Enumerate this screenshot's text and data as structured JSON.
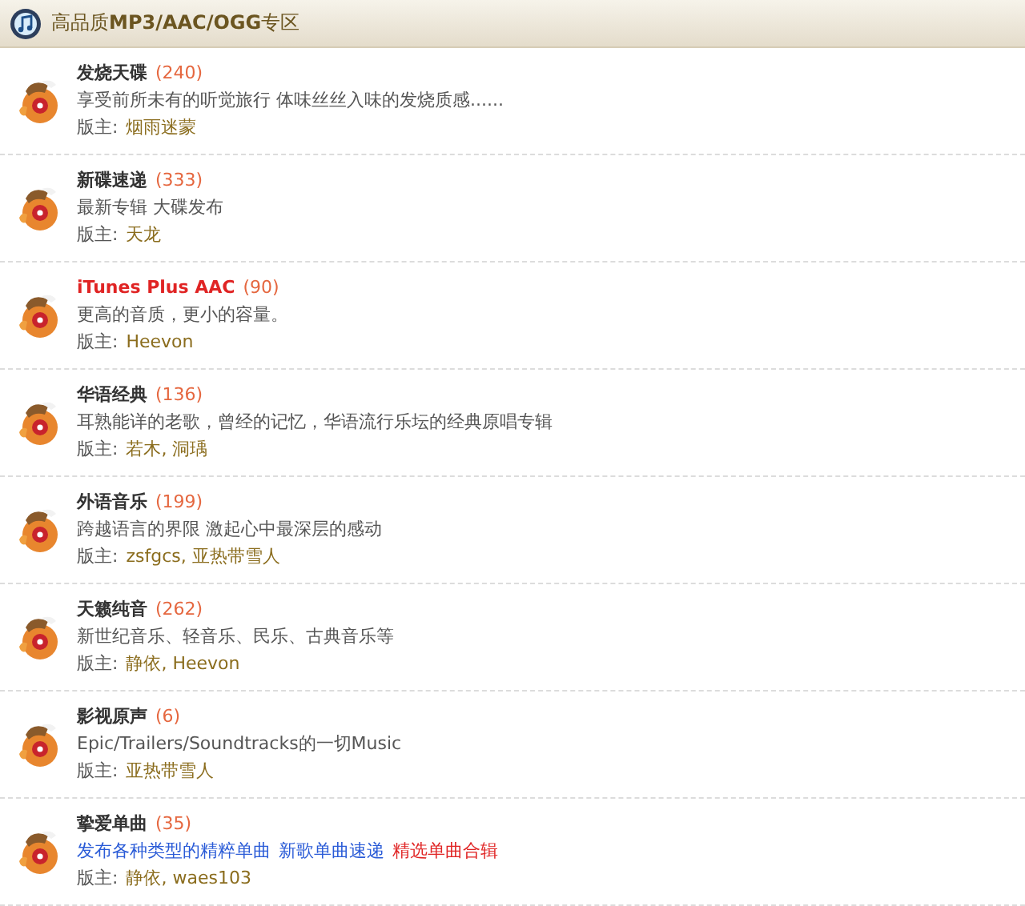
{
  "header": {
    "title": "高品质**MP3/AAC/OGG**专区"
  },
  "forums": [
    {
      "name": "发烧天碟",
      "highlighted": false,
      "count": "(240)",
      "description": [
        {
          "kind": "plain",
          "text": "享受前所未有的听觉旅行 体味丝丝入味的发烧质感......"
        }
      ],
      "moderator_label": "版主:",
      "moderators": "烟雨迷蒙"
    },
    {
      "name": "新碟速递",
      "highlighted": false,
      "count": "(333)",
      "description": [
        {
          "kind": "plain",
          "text": "最新专辑 大碟发布"
        }
      ],
      "moderator_label": "版主:",
      "moderators": "天龙"
    },
    {
      "name": "iTunes Plus AAC",
      "highlighted": true,
      "count": "(90)",
      "description": [
        {
          "kind": "plain",
          "text": "更高的音质，更小的容量。"
        }
      ],
      "moderator_label": "版主:",
      "moderators": "Heevon"
    },
    {
      "name": "华语经典",
      "highlighted": false,
      "count": "(136)",
      "description": [
        {
          "kind": "plain",
          "text": "耳熟能详的老歌，曾经的记忆，华语流行乐坛的经典原唱专辑"
        }
      ],
      "moderator_label": "版主:",
      "moderators": "若木, 洞瑀"
    },
    {
      "name": "外语音乐",
      "highlighted": false,
      "count": "(199)",
      "description": [
        {
          "kind": "plain",
          "text": "跨越语言的界限 激起心中最深层的感动"
        }
      ],
      "moderator_label": "版主:",
      "moderators": "zsfgcs, 亚热带雪人"
    },
    {
      "name": "天籁纯音",
      "highlighted": false,
      "count": "(262)",
      "description": [
        {
          "kind": "plain",
          "text": "新世纪音乐、轻音乐、民乐、古典音乐等"
        }
      ],
      "moderator_label": "版主:",
      "moderators": "静依, Heevon"
    },
    {
      "name": "影视原声",
      "highlighted": false,
      "count": "(6)",
      "description": [
        {
          "kind": "plain",
          "text": "Epic/Trailers/Soundtracks的一切Music"
        }
      ],
      "moderator_label": "版主:",
      "moderators": "亚热带雪人"
    },
    {
      "name": "挚爱单曲",
      "highlighted": false,
      "count": "(35)",
      "description": [
        {
          "kind": "link",
          "text": "发布各种类型的精粹单曲",
          "color": "#2a5bd7"
        },
        {
          "kind": "link",
          "text": "新歌单曲速递",
          "color": "#2a5bd7"
        },
        {
          "kind": "link",
          "text": "精选单曲合辑",
          "color": "#e02424"
        }
      ],
      "moderator_label": "版主:",
      "moderators": "静依, waes103"
    }
  ]
}
